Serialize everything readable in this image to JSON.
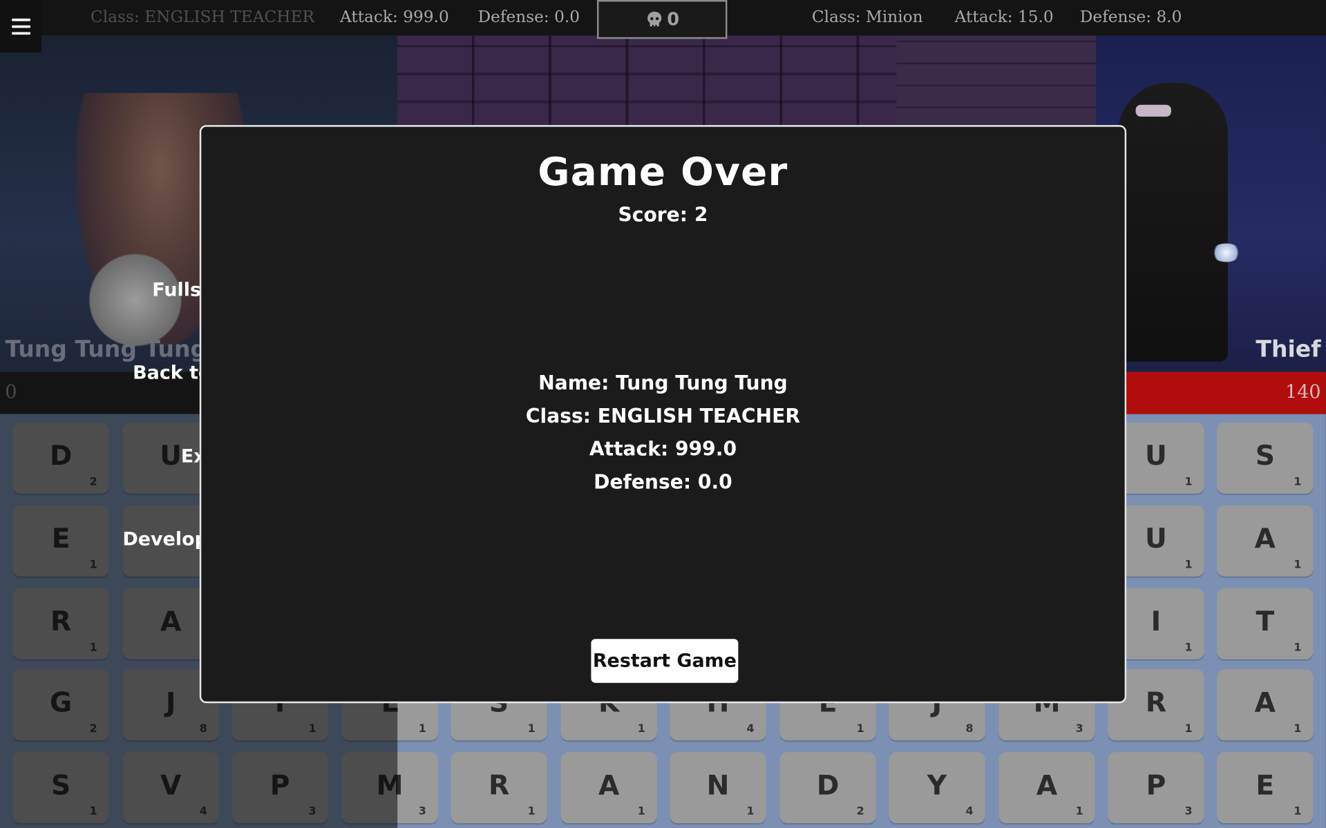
{
  "top_bar": {
    "player_class": "Class: ENGLISH TEACHER",
    "player_attack": "Attack: 999.0",
    "player_defense": "Defense: 0.0",
    "kill_count": "0",
    "enemy_class": "Class: Minion",
    "enemy_attack": "Attack: 15.0",
    "enemy_defense": "Defense: 8.0"
  },
  "battle": {
    "player_name": "Tung Tung Tung",
    "enemy_name": "Thief",
    "player_hp": "0",
    "enemy_hp": "140"
  },
  "side_menu": {
    "fullscreen": "Fullsc",
    "back": "Back to",
    "exit": "Ex",
    "developer": "Develope"
  },
  "board": {
    "tiles": [
      {
        "letter": "D",
        "points": "2"
      },
      {
        "letter": "U",
        "points": ""
      },
      {
        "letter": "",
        "points": ""
      },
      {
        "letter": "",
        "points": ""
      },
      {
        "letter": "",
        "points": ""
      },
      {
        "letter": "",
        "points": ""
      },
      {
        "letter": "",
        "points": ""
      },
      {
        "letter": "",
        "points": ""
      },
      {
        "letter": "",
        "points": ""
      },
      {
        "letter": "",
        "points": ""
      },
      {
        "letter": "U",
        "points": "1"
      },
      {
        "letter": "S",
        "points": "1"
      },
      {
        "letter": "E",
        "points": "1"
      },
      {
        "letter": "",
        "points": ""
      },
      {
        "letter": "",
        "points": ""
      },
      {
        "letter": "",
        "points": ""
      },
      {
        "letter": "",
        "points": ""
      },
      {
        "letter": "",
        "points": ""
      },
      {
        "letter": "",
        "points": ""
      },
      {
        "letter": "",
        "points": ""
      },
      {
        "letter": "",
        "points": ""
      },
      {
        "letter": "",
        "points": ""
      },
      {
        "letter": "U",
        "points": "1"
      },
      {
        "letter": "A",
        "points": "1"
      },
      {
        "letter": "R",
        "points": "1"
      },
      {
        "letter": "A",
        "points": ""
      },
      {
        "letter": "",
        "points": ""
      },
      {
        "letter": "",
        "points": ""
      },
      {
        "letter": "",
        "points": ""
      },
      {
        "letter": "",
        "points": ""
      },
      {
        "letter": "",
        "points": ""
      },
      {
        "letter": "",
        "points": ""
      },
      {
        "letter": "",
        "points": ""
      },
      {
        "letter": "",
        "points": ""
      },
      {
        "letter": "I",
        "points": "1"
      },
      {
        "letter": "T",
        "points": "1"
      },
      {
        "letter": "G",
        "points": "2"
      },
      {
        "letter": "J",
        "points": "8"
      },
      {
        "letter": "I",
        "points": "1"
      },
      {
        "letter": "L",
        "points": "1"
      },
      {
        "letter": "S",
        "points": "1"
      },
      {
        "letter": "K",
        "points": "1"
      },
      {
        "letter": "H",
        "points": "4"
      },
      {
        "letter": "E",
        "points": "1"
      },
      {
        "letter": "J",
        "points": "8"
      },
      {
        "letter": "M",
        "points": "3"
      },
      {
        "letter": "R",
        "points": "1"
      },
      {
        "letter": "A",
        "points": "1"
      },
      {
        "letter": "S",
        "points": "1"
      },
      {
        "letter": "V",
        "points": "4"
      },
      {
        "letter": "P",
        "points": "3"
      },
      {
        "letter": "M",
        "points": "3"
      },
      {
        "letter": "R",
        "points": "1"
      },
      {
        "letter": "A",
        "points": "1"
      },
      {
        "letter": "N",
        "points": "1"
      },
      {
        "letter": "D",
        "points": "2"
      },
      {
        "letter": "Y",
        "points": "4"
      },
      {
        "letter": "A",
        "points": "1"
      },
      {
        "letter": "P",
        "points": "3"
      },
      {
        "letter": "E",
        "points": "1"
      }
    ]
  },
  "modal": {
    "title": "Game Over",
    "score": "Score: 2",
    "name": "Name: Tung Tung Tung",
    "class": "Class: ENGLISH TEACHER",
    "attack": "Attack: 999.0",
    "defense": "Defense: 0.0",
    "restart_label": "Restart Game"
  }
}
